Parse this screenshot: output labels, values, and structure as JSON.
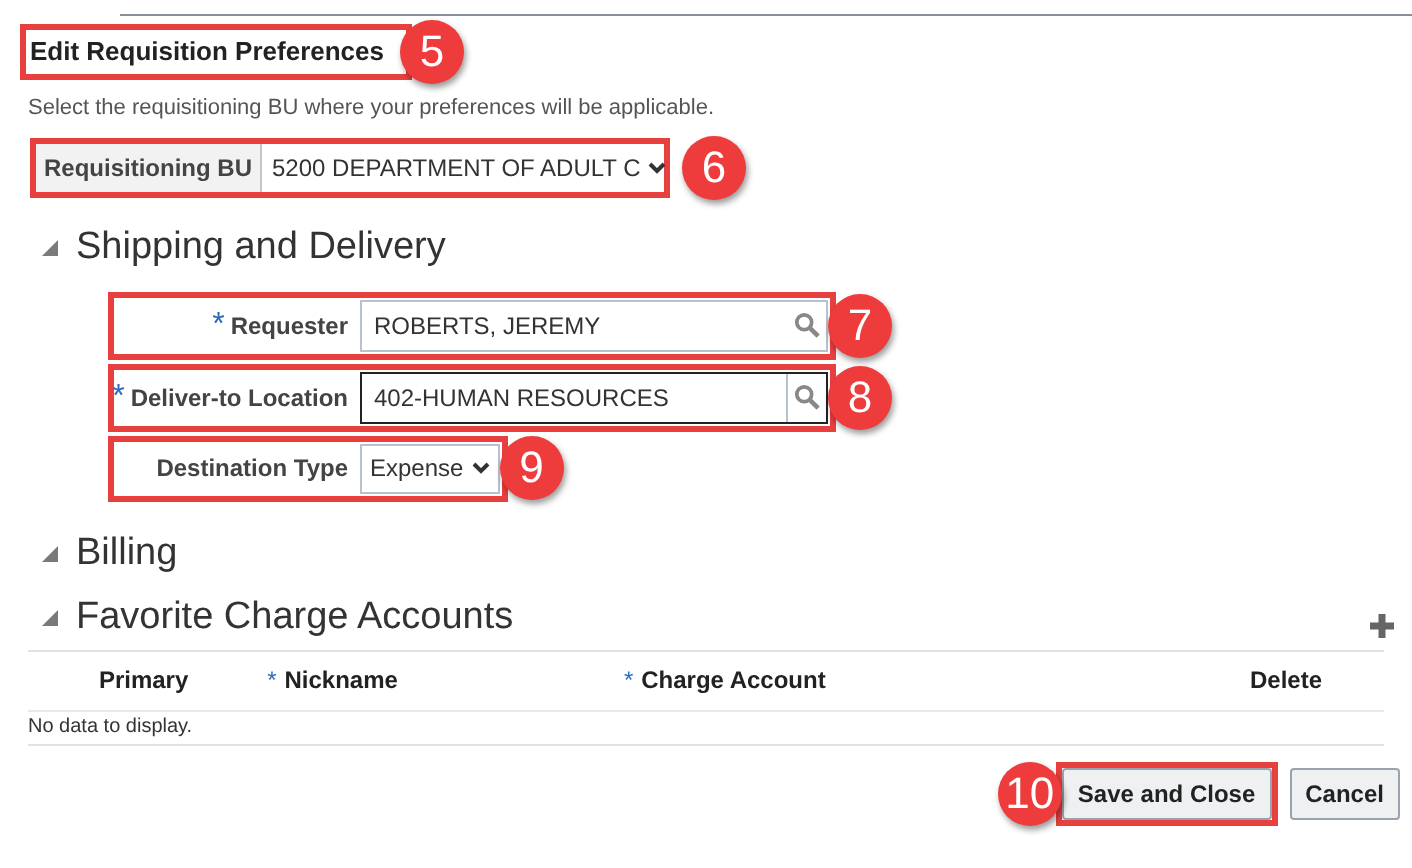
{
  "header": {
    "title": "Edit Requisition Preferences",
    "callout": "5"
  },
  "instruction": "Select the requisitioning BU where your preferences will be applicable.",
  "bu": {
    "label": "Requisitioning BU",
    "value": "5200 DEPARTMENT OF ADULT C",
    "callout": "6"
  },
  "shipping": {
    "title": "Shipping and Delivery",
    "expanded": true,
    "fields": [
      {
        "kind": "lookup",
        "label": "Requester",
        "marker": "*",
        "value": "ROBERTS, JEREMY",
        "focused": false,
        "callout": "7"
      },
      {
        "kind": "lookup",
        "label": "Deliver-to Location",
        "marker": "*",
        "value": "402-HUMAN RESOURCES",
        "focused": true,
        "callout": "8"
      },
      {
        "kind": "select",
        "label": "Destination Type",
        "value": "Expense",
        "focused": false,
        "callout": "9"
      }
    ]
  },
  "billing": {
    "title": "Billing",
    "expanded": true
  },
  "charge_accounts": {
    "title": "Favorite Charge Accounts",
    "expanded": true,
    "columns": [
      {
        "label": "Primary"
      },
      {
        "label": "Nickname",
        "marker": "*"
      },
      {
        "label": "Charge Account",
        "marker": "*"
      },
      {
        "label": "Delete"
      }
    ],
    "empty_message": "No data to display."
  },
  "buttons": [
    {
      "label": "Save and Close",
      "callout": "10"
    },
    {
      "label": "Cancel"
    }
  ]
}
